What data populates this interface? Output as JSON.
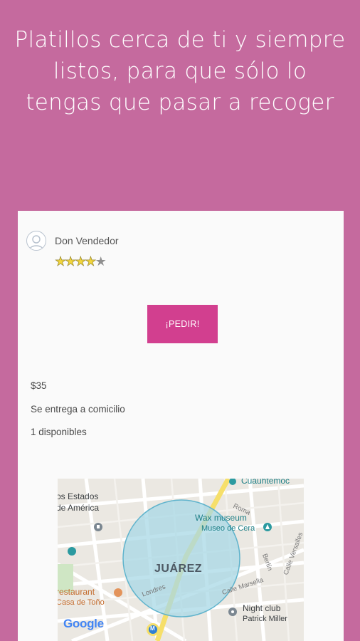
{
  "headline": "Platillos cerca de ti y siempre listos, para que sólo lo tengas que pasar a recoger",
  "seller": {
    "name": "Don Vendedor",
    "rating": 4,
    "rating_max": 5
  },
  "order_button": {
    "label": "¡PEDIR!"
  },
  "details": {
    "price": "$35",
    "delivery": "Se entrega a comicilio",
    "available": "1 disponibles"
  },
  "map": {
    "labels": {
      "cuauhtemoc": "Cuauhtémoc",
      "estados_1": "os Estados",
      "estados_2": "de América",
      "wax": "Wax museum",
      "museo": "Museo de Cera",
      "roma": "Roma",
      "berlin": "Berlín",
      "calle_versalles": "Calle Versalles",
      "restaurant": "restaurant",
      "casa_tono": "Casa de Toño",
      "londres": "Londres",
      "calle_marsella": "Calle Marsella",
      "night_club": "Night club",
      "patrick": "Patrick Miller",
      "district": "JUÁREZ",
      "google": "Google",
      "metro": "M"
    },
    "colors": {
      "radius_fill": "#a8d8e6",
      "radius_stroke": "#5fb3cc",
      "avenue": "#f6df6a"
    }
  },
  "colors": {
    "background": "#c56a9e",
    "accent": "#d23f8f"
  }
}
